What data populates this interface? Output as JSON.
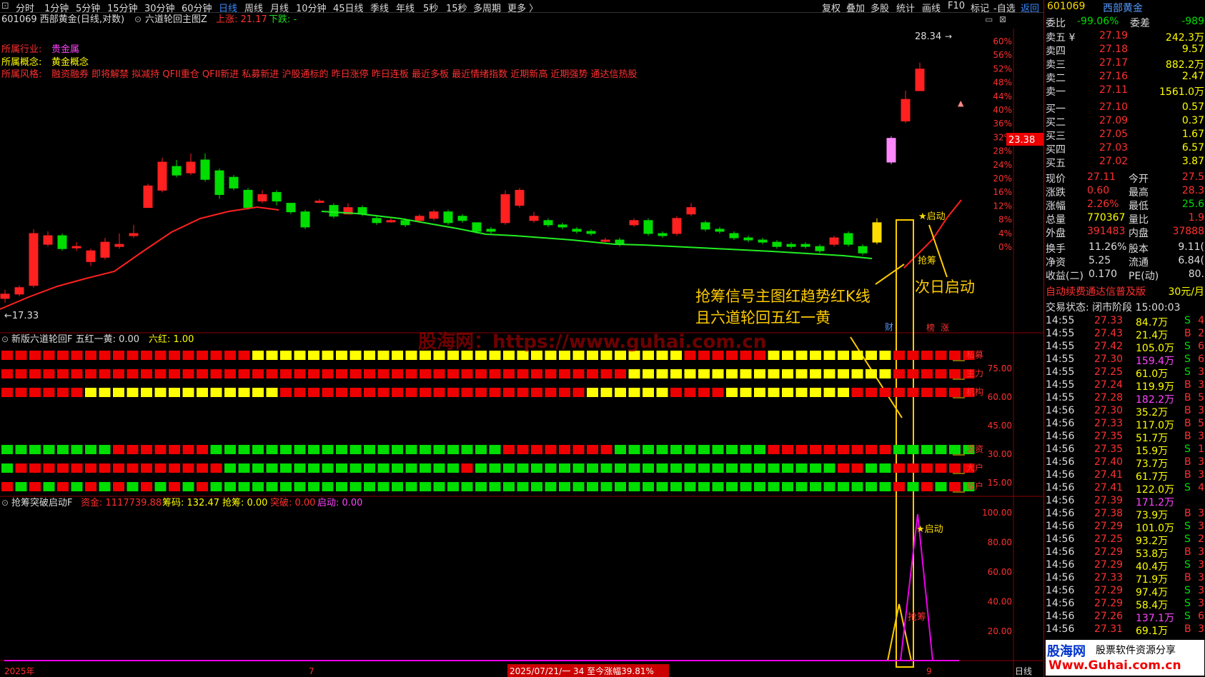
{
  "toolbar": {
    "intervals": [
      "分时",
      "1分钟",
      "5分钟",
      "15分钟",
      "30分钟",
      "60分钟",
      "日线",
      "周线",
      "月线",
      "10分钟",
      "45日线",
      "季线",
      "年线",
      "5秒",
      "15秒",
      "多周期",
      "更多 〉"
    ],
    "active": "日线",
    "right_tools": [
      "复权",
      "叠加",
      "多股",
      "统计",
      "画线",
      "F10",
      "标记",
      "-自选",
      "返回"
    ]
  },
  "main_panel": {
    "title": "601069 西部黄金(日线,对数)",
    "indicator": "六道轮回主图Z",
    "up_label": "上涨: 21.17",
    "down_label": "下跌: -",
    "industry_label": "所属行业:",
    "industry": "贵金属",
    "concept_label": "所属概念:",
    "concept": "黄金概念",
    "style_label": "所属风格:",
    "style_tags": "融资融券 即将解禁 拟减持 QFII重仓 QFII新进 私募新进 沪股通标的 昨日涨停 昨日连板 最近多板 最近情绪指数 近期新高 近期强势 通达信热股",
    "high_label": "28.34",
    "low_label": "17.33",
    "price_marker": "23.38",
    "pct_ticks": [
      "60%",
      "56%",
      "52%",
      "48%",
      "44%",
      "40%",
      "36%",
      "32%",
      "28%",
      "24%",
      "20%",
      "16%",
      "12%",
      "8%",
      "4%",
      "0%"
    ],
    "annot_qiangchou": "抢筹",
    "annot_qidong": "★启动",
    "annotation_1": "抢筹信号主图红趋势红K线",
    "annotation_2": "且六道轮回五红一黄",
    "annotation_3": "次日启动",
    "small_marks": [
      "财",
      "榜",
      "涨"
    ]
  },
  "grid_panel": {
    "title": "新版六道轮回F 五红一黄: 0.00",
    "six_red": "六红: 1.00",
    "rows": [
      "私募",
      "主力",
      "机构",
      "游资",
      "大户",
      "散户"
    ],
    "y_ticks": [
      "75.00",
      "60.00",
      "45.00",
      "30.00",
      "15.00"
    ]
  },
  "bottom_panel": {
    "title": "抢筹突破启动F",
    "fund": "资金: 1117739.88",
    "chips": "筹码: 132.47",
    "grab": "抢筹: 0.00",
    "breakthrough": "突破: 0.00",
    "start": "启动: 0.00",
    "y_ticks": [
      "100.00",
      "80.00",
      "60.00",
      "40.00",
      "20.00"
    ],
    "annot_start": "★启动",
    "annot_grab": "抢筹"
  },
  "axis": {
    "left_label": "2025年",
    "mid_label": "7",
    "right_label": "9",
    "status": "2025/07/21/一 34 至今涨幅39.81%",
    "period": "日线"
  },
  "watermark": "股海网：https://www.guhai.com.cn",
  "sidebar": {
    "code": "601069",
    "name": "西部黄金",
    "wb_label": "委比",
    "wb": "-99.06%",
    "wc_label": "委差",
    "wc": "-989",
    "asks": [
      {
        "label": "卖五 ¥",
        "price": "27.19",
        "vol": "242.3万"
      },
      {
        "label": "卖四",
        "price": "27.18",
        "vol": "9.57"
      },
      {
        "label": "卖三",
        "price": "27.17",
        "vol": "882.2万"
      },
      {
        "label": "卖二",
        "price": "27.16",
        "vol": "2.47"
      },
      {
        "label": "卖一",
        "price": "27.11",
        "vol": "1561.0万"
      }
    ],
    "bids": [
      {
        "label": "买一",
        "price": "27.10",
        "vol": "0.57"
      },
      {
        "label": "买二",
        "price": "27.09",
        "vol": "0.37"
      },
      {
        "label": "买三",
        "price": "27.05",
        "vol": "1.67"
      },
      {
        "label": "买四",
        "price": "27.03",
        "vol": "6.57"
      },
      {
        "label": "买五",
        "price": "27.02",
        "vol": "3.87"
      }
    ],
    "quote": [
      {
        "l1": "现价",
        "v1": "27.11",
        "l2": "今开",
        "v2": "27.5"
      },
      {
        "l1": "涨跌",
        "v1": "0.60",
        "l2": "最高",
        "v2": "28.3"
      },
      {
        "l1": "涨幅",
        "v1": "2.26%",
        "l2": "最低",
        "v2": "25.6"
      },
      {
        "l1": "总量",
        "v1": "770367",
        "l2": "量比",
        "v2": "1.9"
      },
      {
        "l1": "外盘",
        "v1": "391483",
        "l2": "内盘",
        "v2": "37888"
      }
    ],
    "quote2": [
      {
        "l1": "换手",
        "v1": "11.26%",
        "l2": "股本",
        "v2": "9.11("
      },
      {
        "l1": "净资",
        "v1": "5.25",
        "l2": "流通",
        "v2": "6.84("
      },
      {
        "l1": "收益(二)",
        "v1": "0.170",
        "l2": "PE(动)",
        "v2": "80."
      }
    ],
    "promo": "自动续费通达信普及版",
    "promo_price": "30元/月",
    "trade_status": "交易状态: 闭市阶段 15:00:03",
    "ticks": [
      [
        "14:55",
        "27.33",
        "84.7万",
        "S",
        "4"
      ],
      [
        "14:55",
        "27.43",
        "21.4万",
        "B",
        "2"
      ],
      [
        "14:55",
        "27.42",
        "105.0万",
        "S",
        "6"
      ],
      [
        "14:55",
        "27.30",
        "159.4万",
        "S",
        "6"
      ],
      [
        "14:55",
        "27.25",
        "61.0万",
        "S",
        "3"
      ],
      [
        "14:55",
        "27.24",
        "119.9万",
        "B",
        "3"
      ],
      [
        "14:55",
        "27.28",
        "182.2万",
        "B",
        "5"
      ],
      [
        "14:56",
        "27.30",
        "35.2万",
        "B",
        "3"
      ],
      [
        "14:56",
        "27.33",
        "117.0万",
        "B",
        "5"
      ],
      [
        "14:56",
        "27.35",
        "51.7万",
        "B",
        "3"
      ],
      [
        "14:56",
        "27.35",
        "15.9万",
        "S",
        "1"
      ],
      [
        "14:56",
        "27.40",
        "73.7万",
        "B",
        "3"
      ],
      [
        "14:56",
        "27.41",
        "61.7万",
        "B",
        "3"
      ],
      [
        "14:56",
        "27.41",
        "122.0万",
        "S",
        "4"
      ],
      [
        "14:56",
        "27.39",
        "171.2万",
        "",
        ""
      ],
      [
        "14:56",
        "27.38",
        "73.9万",
        "B",
        "3"
      ],
      [
        "14:56",
        "27.29",
        "101.0万",
        "S",
        "3"
      ],
      [
        "14:56",
        "27.25",
        "93.2万",
        "S",
        "2"
      ],
      [
        "14:56",
        "27.29",
        "53.8万",
        "B",
        "3"
      ],
      [
        "14:56",
        "27.29",
        "40.4万",
        "S",
        "3"
      ],
      [
        "14:56",
        "27.33",
        "71.9万",
        "B",
        "3"
      ],
      [
        "14:56",
        "27.29",
        "97.4万",
        "S",
        "3"
      ],
      [
        "14:56",
        "27.29",
        "58.4万",
        "S",
        "3"
      ],
      [
        "14:56",
        "27.26",
        "137.1万",
        "S",
        "6"
      ],
      [
        "14:56",
        "27.31",
        "69.1万",
        "B",
        "3"
      ]
    ],
    "logo_1": "股海网",
    "logo_2": "股票软件资源分享",
    "logo_3": "Www.Guhai.com.cn"
  }
}
